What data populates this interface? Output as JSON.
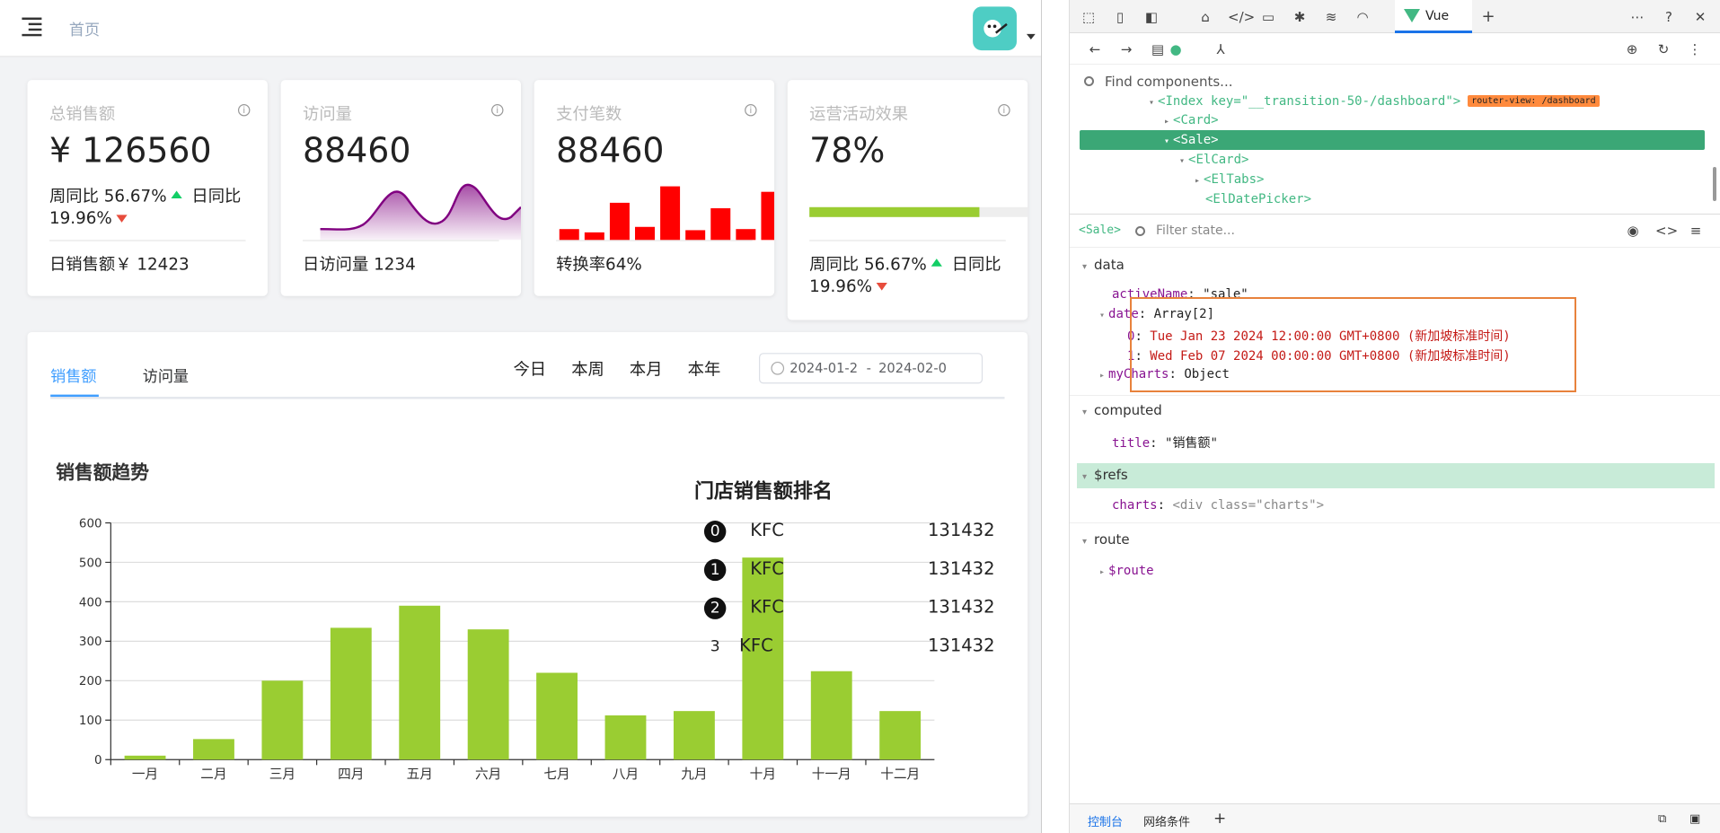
{
  "header": {
    "breadcrumb": "首页"
  },
  "cards": [
    {
      "title": "总销售额",
      "value": "¥ 126560",
      "week_label": "周同比",
      "week_value": "56.67%",
      "day_label": "日同比",
      "day_value": "19.96%",
      "foot": "日销售额￥ 12423"
    },
    {
      "title": "访问量",
      "value": "88460",
      "foot": "日访问量 1234"
    },
    {
      "title": "支付笔数",
      "value": "88460",
      "foot": "转换率64%"
    },
    {
      "title": "运营活动效果",
      "value": "78%",
      "progress": 0.78,
      "week_label": "周同比",
      "week_value": "56.67%",
      "day_label": "日同比",
      "day_value": "19.96%"
    }
  ],
  "sales": {
    "tabs": [
      "销售额",
      "访问量"
    ],
    "ranges": [
      "今日",
      "本周",
      "本月",
      "本年"
    ],
    "date_from": "2024-01-2",
    "date_sep": "-",
    "date_to": "2024-02-0",
    "chart_title": "销售额趋势",
    "rank_title": "门店销售额排名",
    "ranking": [
      {
        "rank": "0",
        "name": "KFC",
        "value": "131432"
      },
      {
        "rank": "1",
        "name": "KFC",
        "value": "131432"
      },
      {
        "rank": "2",
        "name": "KFC",
        "value": "131432"
      },
      {
        "rank": "3",
        "name": "KFC",
        "value": "131432"
      }
    ]
  },
  "chart_data": {
    "type": "bar",
    "categories": [
      "一月",
      "二月",
      "三月",
      "四月",
      "五月",
      "六月",
      "七月",
      "八月",
      "九月",
      "十月",
      "十一月",
      "十二月"
    ],
    "values": [
      10,
      52,
      200,
      334,
      390,
      330,
      220,
      112,
      123,
      512,
      224,
      123
    ],
    "yticks": [
      0,
      100,
      200,
      300,
      400,
      500,
      600
    ],
    "ylim": [
      0,
      600
    ],
    "color": "#9acd32"
  },
  "devtools": {
    "vue_tab": "Vue",
    "find_placeholder": "Find components...",
    "tree": [
      {
        "text": "<Index key=\"__transition-50-/dashboard\">",
        "tag": "router-view: /dashboard"
      },
      {
        "text": "<Card>"
      },
      {
        "text": "<Sale>"
      },
      {
        "text": "<ElCard>"
      },
      {
        "text": "<ElTabs>"
      },
      {
        "text": "<ElDatePicker>"
      }
    ],
    "state_comp": "<Sale>",
    "filter_placeholder": "Filter state...",
    "sections": {
      "data": "data",
      "computed": "computed",
      "refs": "$refs",
      "route": "route"
    },
    "state": {
      "activeName_key": "activeName",
      "activeName_val": "\"sale\"",
      "date_key": "date",
      "date_val": "Array[2]",
      "date0_key": "0",
      "date0_val": "Tue Jan 23 2024 12:00:00 GMT+0800 (新加坡标准时间)",
      "date1_key": "1",
      "date1_val": "Wed Feb 07 2024 00:00:00 GMT+0800 (新加坡标准时间)",
      "myCharts_key": "myCharts",
      "myCharts_val": "Object",
      "title_key": "title",
      "title_val": "\"销售额\"",
      "charts_key": "charts",
      "charts_val": "<div class=\"charts\">",
      "route_key": "$route"
    },
    "bottom_tabs": [
      "控制台",
      "网络条件"
    ]
  },
  "colors": {
    "accent": "#409eff",
    "vue_green": "#42b883",
    "bar_green": "#9acd32",
    "visit_purple": "#800080",
    "pay_red": "#ff0000"
  }
}
